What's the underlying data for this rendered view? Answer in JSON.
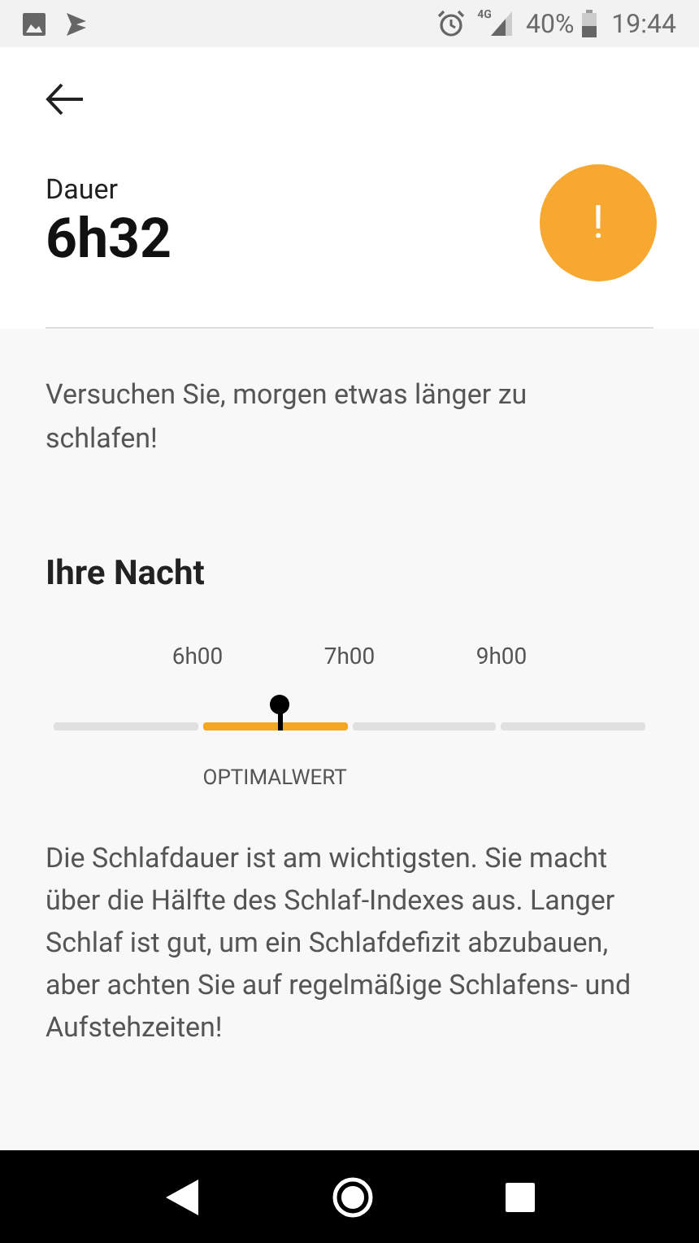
{
  "status_bar": {
    "network": "4G",
    "battery": "40%",
    "time": "19:44"
  },
  "header": {
    "label": "Dauer",
    "value": "6h32",
    "alert": "!"
  },
  "advice": "Versuchen Sie, morgen etwas länger zu schlafen!",
  "night": {
    "title": "Ihre Nacht",
    "ticks": [
      "6h00",
      "7h00",
      "9h00"
    ],
    "segments": [
      {
        "color": "#e0e0e0"
      },
      {
        "color": "#f5a623",
        "caption": "OPTIMALWERT"
      },
      {
        "color": "#e0e0e0"
      },
      {
        "color": "#e0e0e0"
      }
    ]
  },
  "description": "Die Schlafdauer ist am wichtigsten. Sie macht über die Hälfte des Schlaf-Indexes aus. Langer Schlaf ist gut, um ein Schlafdefizit abzubauen, aber achten Sie auf regelmäßige Schlafens- und Aufstehzeiten!"
}
